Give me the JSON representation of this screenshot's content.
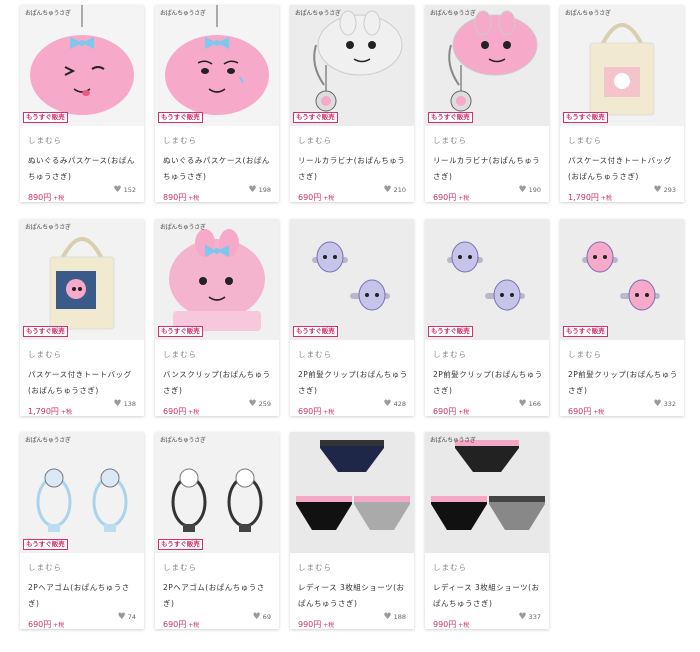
{
  "products": [
    {
      "brand": "しまむら",
      "name": "ぬいぐるみパスケース(おぱんちゅうさぎ)",
      "price": "890円",
      "tax": "+税",
      "likes": "152",
      "badge": "もうすぐ販売",
      "logo": "おぱんちゅうさぎ"
    },
    {
      "brand": "しまむら",
      "name": "ぬいぐるみパスケース(おぱんちゅうさぎ)",
      "price": "890円",
      "tax": "+税",
      "likes": "198",
      "badge": "もうすぐ販売",
      "logo": "おぱんちゅうさぎ"
    },
    {
      "brand": "しまむら",
      "name": "リールカラビナ(おぱんちゅうさぎ)",
      "price": "690円",
      "tax": "+税",
      "likes": "210",
      "badge": "もうすぐ販売",
      "logo": "おぱんちゅうさぎ"
    },
    {
      "brand": "しまむら",
      "name": "リールカラビナ(おぱんちゅうさぎ)",
      "price": "690円",
      "tax": "+税",
      "likes": "190",
      "badge": "もうすぐ販売",
      "logo": "おぱんちゅうさぎ"
    },
    {
      "brand": "しまむら",
      "name": "パスケース付きトートバッグ(おぱんちゅうさぎ)",
      "price": "1,790円",
      "tax": "+税",
      "likes": "293",
      "badge": "もうすぐ販売",
      "logo": "おぱんちゅうさぎ"
    },
    {
      "brand": "しまむら",
      "name": "パスケース付きトートバッグ(おぱんちゅうさぎ)",
      "price": "1,790円",
      "tax": "+税",
      "likes": "138",
      "badge": "もうすぐ販売",
      "logo": "おぱんちゅうさぎ"
    },
    {
      "brand": "しまむら",
      "name": "バンスクリップ(おぱんちゅうさぎ)",
      "price": "690円",
      "tax": "+税",
      "likes": "259",
      "badge": "もうすぐ販売",
      "logo": "おぱんちゅうさぎ"
    },
    {
      "brand": "しまむら",
      "name": "2P前髪クリップ(おぱんちゅうさぎ)",
      "price": "690円",
      "tax": "+税",
      "likes": "428",
      "badge": "もうすぐ販売",
      "logo": ""
    },
    {
      "brand": "しまむら",
      "name": "2P前髪クリップ(おぱんちゅうさぎ)",
      "price": "690円",
      "tax": "+税",
      "likes": "166",
      "badge": "もうすぐ販売",
      "logo": ""
    },
    {
      "brand": "しまむら",
      "name": "2P前髪クリップ(おぱんちゅうさぎ)",
      "price": "690円",
      "tax": "+税",
      "likes": "332",
      "badge": "もうすぐ販売",
      "logo": ""
    },
    {
      "brand": "しまむら",
      "name": "2Pヘアゴム(おぱんちゅうさぎ)",
      "price": "690円",
      "tax": "+税",
      "likes": "74",
      "badge": "もうすぐ販売",
      "logo": "おぱんちゅうさぎ"
    },
    {
      "brand": "しまむら",
      "name": "2Pヘアゴム(おぱんちゅうさぎ)",
      "price": "690円",
      "tax": "+税",
      "likes": "69",
      "badge": "もうすぐ販売",
      "logo": "おぱんちゅうさぎ"
    },
    {
      "brand": "しまむら",
      "name": "レディース 3枚組ショーツ(おぱんちゅうさぎ)",
      "price": "990円",
      "tax": "+税",
      "likes": "188",
      "badge": "",
      "logo": ""
    },
    {
      "brand": "しまむら",
      "name": "レディース 3枚組ショーツ(おぱんちゅうさぎ)",
      "price": "990円",
      "tax": "+税",
      "likes": "337",
      "badge": "",
      "logo": "おぱんちゅうさぎ"
    }
  ],
  "colors": {
    "accent": "#d0306b",
    "pink": "#f6a9c8",
    "blue": "#7ec8ee"
  }
}
